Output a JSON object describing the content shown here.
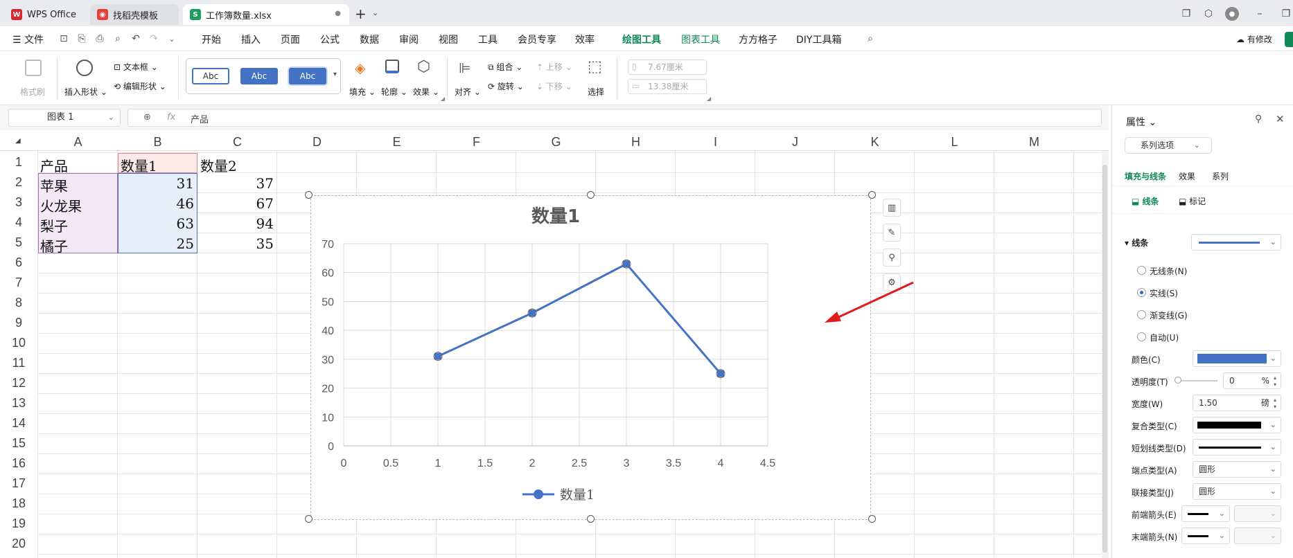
{
  "tabs": [
    {
      "label": "WPS Office",
      "icon": "wps-logo-icon"
    },
    {
      "label": "找稻壳模板",
      "icon": "docer-icon"
    },
    {
      "label": "工作簿数量.xlsx",
      "icon": "spreadsheet-icon"
    }
  ],
  "menu": {
    "file": "文件",
    "items": [
      "开始",
      "插入",
      "页面",
      "公式",
      "数据",
      "审阅",
      "视图",
      "工具",
      "会员专享",
      "效率",
      "绘图工具",
      "图表工具",
      "方方格子",
      "DIY工具箱"
    ],
    "modified": "有修改"
  },
  "ribbon": {
    "format_painter": "格式刷",
    "insert_shape": "插入形状",
    "textbox": "文本框",
    "edit_shape": "编辑形状",
    "style_samples": [
      "Abc",
      "Abc",
      "Abc"
    ],
    "fill": "填充",
    "outline": "轮廓",
    "effect": "效果",
    "align": "对齐",
    "group": "组合",
    "rotate": "旋转",
    "bring_forward": "上移",
    "send_backward": "下移",
    "select": "选择",
    "height": "7.67厘米",
    "width": "13.38厘米"
  },
  "formula_bar": {
    "name_box": "图表 1",
    "fx": "fx",
    "content": "产品"
  },
  "grid": {
    "columns": [
      "A",
      "B",
      "C",
      "D",
      "E",
      "F",
      "G",
      "H",
      "I",
      "J",
      "K",
      "L",
      "M"
    ],
    "rows": [
      "1",
      "2",
      "3",
      "4",
      "5",
      "6",
      "7",
      "8",
      "9",
      "10",
      "11",
      "12",
      "13",
      "14",
      "15",
      "16",
      "17",
      "18",
      "19",
      "20"
    ],
    "header": [
      "产品",
      "数量1",
      "数量2"
    ],
    "data": [
      {
        "product": "苹果",
        "q1": "31",
        "q2": "37"
      },
      {
        "product": "火龙果",
        "q1": "46",
        "q2": "67"
      },
      {
        "product": "梨子",
        "q1": "63",
        "q2": "94"
      },
      {
        "product": "橘子",
        "q1": "25",
        "q2": "35"
      }
    ]
  },
  "chart_data": {
    "type": "line",
    "title": "数量1",
    "x": [
      1,
      2,
      3,
      4
    ],
    "series": [
      {
        "name": "数量1",
        "values": [
          31,
          46,
          63,
          25
        ],
        "color": "#4472c4"
      }
    ],
    "xlim": [
      0,
      4.5
    ],
    "ylim": [
      0,
      70
    ],
    "x_ticks": [
      "0",
      "0.5",
      "1",
      "1.5",
      "2",
      "2.5",
      "3",
      "3.5",
      "4",
      "4.5"
    ],
    "y_ticks": [
      "0",
      "10",
      "20",
      "30",
      "40",
      "50",
      "60",
      "70"
    ],
    "grid": true,
    "legend": "bottom"
  },
  "panel": {
    "title": "属性",
    "series_options": "系列选项",
    "tabs": [
      "填充与线条",
      "效果",
      "系列"
    ],
    "subtabs": [
      "线条",
      "标记"
    ],
    "section": "线条",
    "line_options": [
      "无线条(N)",
      "实线(S)",
      "渐变线(G)",
      "自动(U)"
    ],
    "selected_option": "实线(S)",
    "color_label": "颜色(C)",
    "color_value": "#4472c4",
    "transparency_label": "透明度(T)",
    "transparency_value": "0",
    "transparency_unit": "%",
    "width_label": "宽度(W)",
    "width_value": "1.50",
    "width_unit": "磅",
    "compound_label": "复合类型(C)",
    "dash_label": "短划线类型(D)",
    "cap_label": "端点类型(A)",
    "cap_value": "圆形",
    "join_label": "联接类型(J)",
    "join_value": "圆形",
    "begin_arrow_label": "前端箭头(E)",
    "end_arrow_label": "末端箭头(N)"
  }
}
